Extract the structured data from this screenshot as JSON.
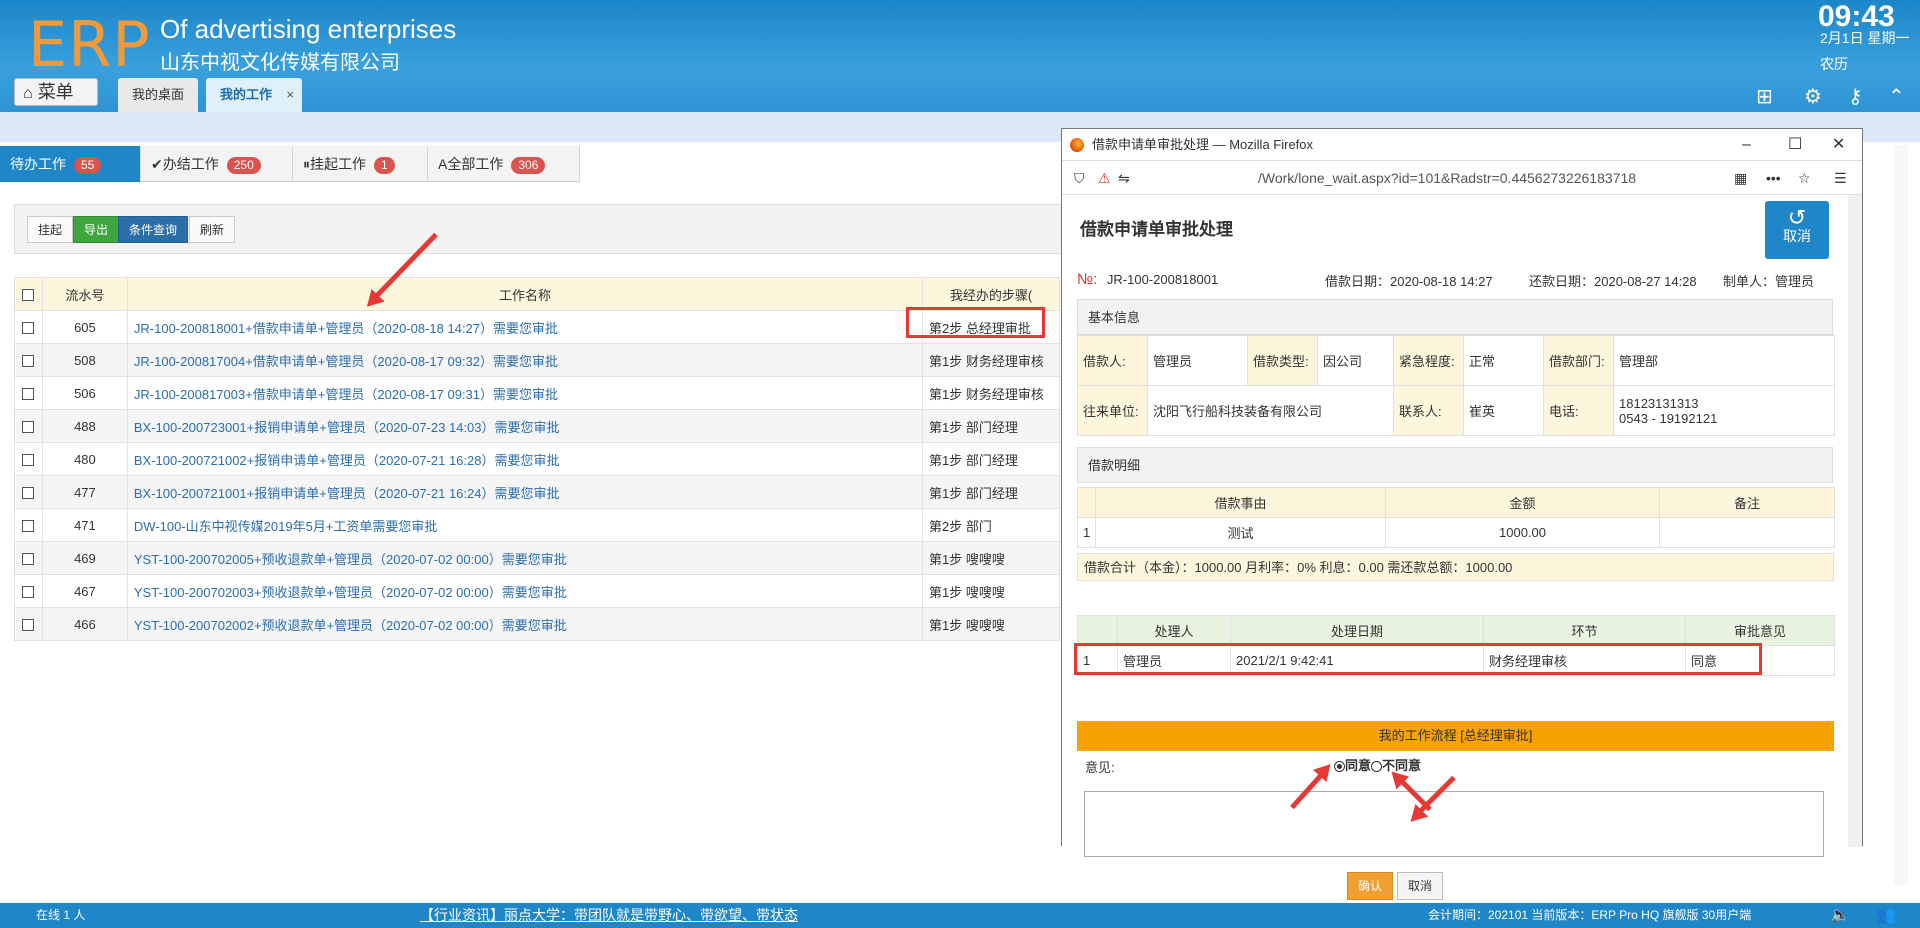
{
  "header": {
    "logo": "ERP",
    "company_en": "Of advertising enterprises",
    "company_cn": "山东中视文化传媒有限公司",
    "time": "09:43",
    "date": "2月1日 星期一",
    "lunar": "农历",
    "menu_label": "菜单",
    "tabs": [
      {
        "label": "我的桌面"
      },
      {
        "label": "我的工作"
      }
    ],
    "tab_close": "×"
  },
  "work_tabs": [
    {
      "label": "待办工作",
      "count": "55"
    },
    {
      "label": "办结工作",
      "count": "250"
    },
    {
      "label": "挂起工作",
      "count": "1"
    },
    {
      "label": "全部工作",
      "count": "306"
    }
  ],
  "toolbar": {
    "suspend": "挂起",
    "export": "导出",
    "query": "条件查询",
    "refresh": "刷新"
  },
  "table": {
    "headers": [
      "流水号",
      "工作名称",
      "我经办的步骤("
    ],
    "rows": [
      {
        "id": "605",
        "name": "JR-100-200818001+借款申请单+管理员（2020-08-18 14:27）需要您审批",
        "step": "第2步 总经理审批"
      },
      {
        "id": "508",
        "name": "JR-100-200817004+借款申请单+管理员（2020-08-17 09:32）需要您审批",
        "step": "第1步 财务经理审核"
      },
      {
        "id": "506",
        "name": "JR-100-200817003+借款申请单+管理员（2020-08-17 09:31）需要您审批",
        "step": "第1步 财务经理审核"
      },
      {
        "id": "488",
        "name": "BX-100-200723001+报销申请单+管理员（2020-07-23 14:03）需要您审批",
        "step": "第1步 部门经理"
      },
      {
        "id": "480",
        "name": "BX-100-200721002+报销申请单+管理员（2020-07-21 16:28）需要您审批",
        "step": "第1步 部门经理"
      },
      {
        "id": "477",
        "name": "BX-100-200721001+报销申请单+管理员（2020-07-21 16:24）需要您审批",
        "step": "第1步 部门经理"
      },
      {
        "id": "471",
        "name": "DW-100-山东中视传媒2019年5月+工资单需要您审批",
        "step": "第2步 部门"
      },
      {
        "id": "469",
        "name": "YST-100-200702005+预收退款单+管理员（2020-07-02 00:00）需要您审批",
        "step": "第1步 嗖嗖嗖"
      },
      {
        "id": "467",
        "name": "YST-100-200702003+预收退款单+管理员（2020-07-02 00:00）需要您审批",
        "step": "第1步 嗖嗖嗖"
      },
      {
        "id": "466",
        "name": "YST-100-200702002+预收退款单+管理员（2020-07-02 00:00）需要您审批",
        "step": "第1步 嗖嗖嗖"
      }
    ]
  },
  "popup": {
    "window_title": "借款申请单审批处理 — Mozilla Firefox",
    "url": "/Work/lone_wait.aspx?id=101&Radstr=0.4456273226183718",
    "heading": "借款申请单审批处理",
    "cancel_big": "取消",
    "no_label": "№:",
    "no_value": "JR-100-200818001",
    "loan_date": "借款日期：2020-08-18 14:27",
    "repay_date": "还款日期：2020-08-27 14:28",
    "maker": "制单人：管理员",
    "basic_title": "基本信息",
    "basic": {
      "borrower_label": "借款人:",
      "borrower": "管理员",
      "type_label": "借款类型:",
      "type": "因公司",
      "urgency_label": "紧急程度:",
      "urgency": "正常",
      "dept_label": "借款部门:",
      "dept": "管理部",
      "unit_label": "往来单位:",
      "unit": "沈阳飞行船科技装备有限公司",
      "contact_label": "联系人:",
      "contact": "崔英",
      "phone_label": "电话:",
      "phone1": "18123131313",
      "phone2": "0543 - 19192121"
    },
    "detail_title": "借款明细",
    "detail_headers": [
      "借款事由",
      "金额",
      "备注"
    ],
    "detail_row": {
      "no": "1",
      "reason": "测试",
      "amount": "1000.00",
      "remark": ""
    },
    "summary": "借款合计（本金）：1000.00   月利率：0%   利息：0.00   需还款总额：1000.00",
    "hist_headers": [
      "处理人",
      "处理日期",
      "环节",
      "审批意见"
    ],
    "hist_row": {
      "no": "1",
      "handler": "管理员",
      "date": "2021/2/1 9:42:41",
      "stage": "财务经理审核",
      "opinion": "同意"
    },
    "flow_bar": "我的工作流程 [总经理审批]",
    "opinion_label": "意见:",
    "agree": "同意",
    "disagree": "不同意",
    "confirm": "确认",
    "cancel": "取消"
  },
  "footer": {
    "online": "在线  1  人",
    "news": "【行业资讯】丽点大学：带团队就是带野心、带欲望、带状态",
    "info": "会计期间：202101 当前版本：ERP Pro HQ 旗舰版 30用户端"
  }
}
